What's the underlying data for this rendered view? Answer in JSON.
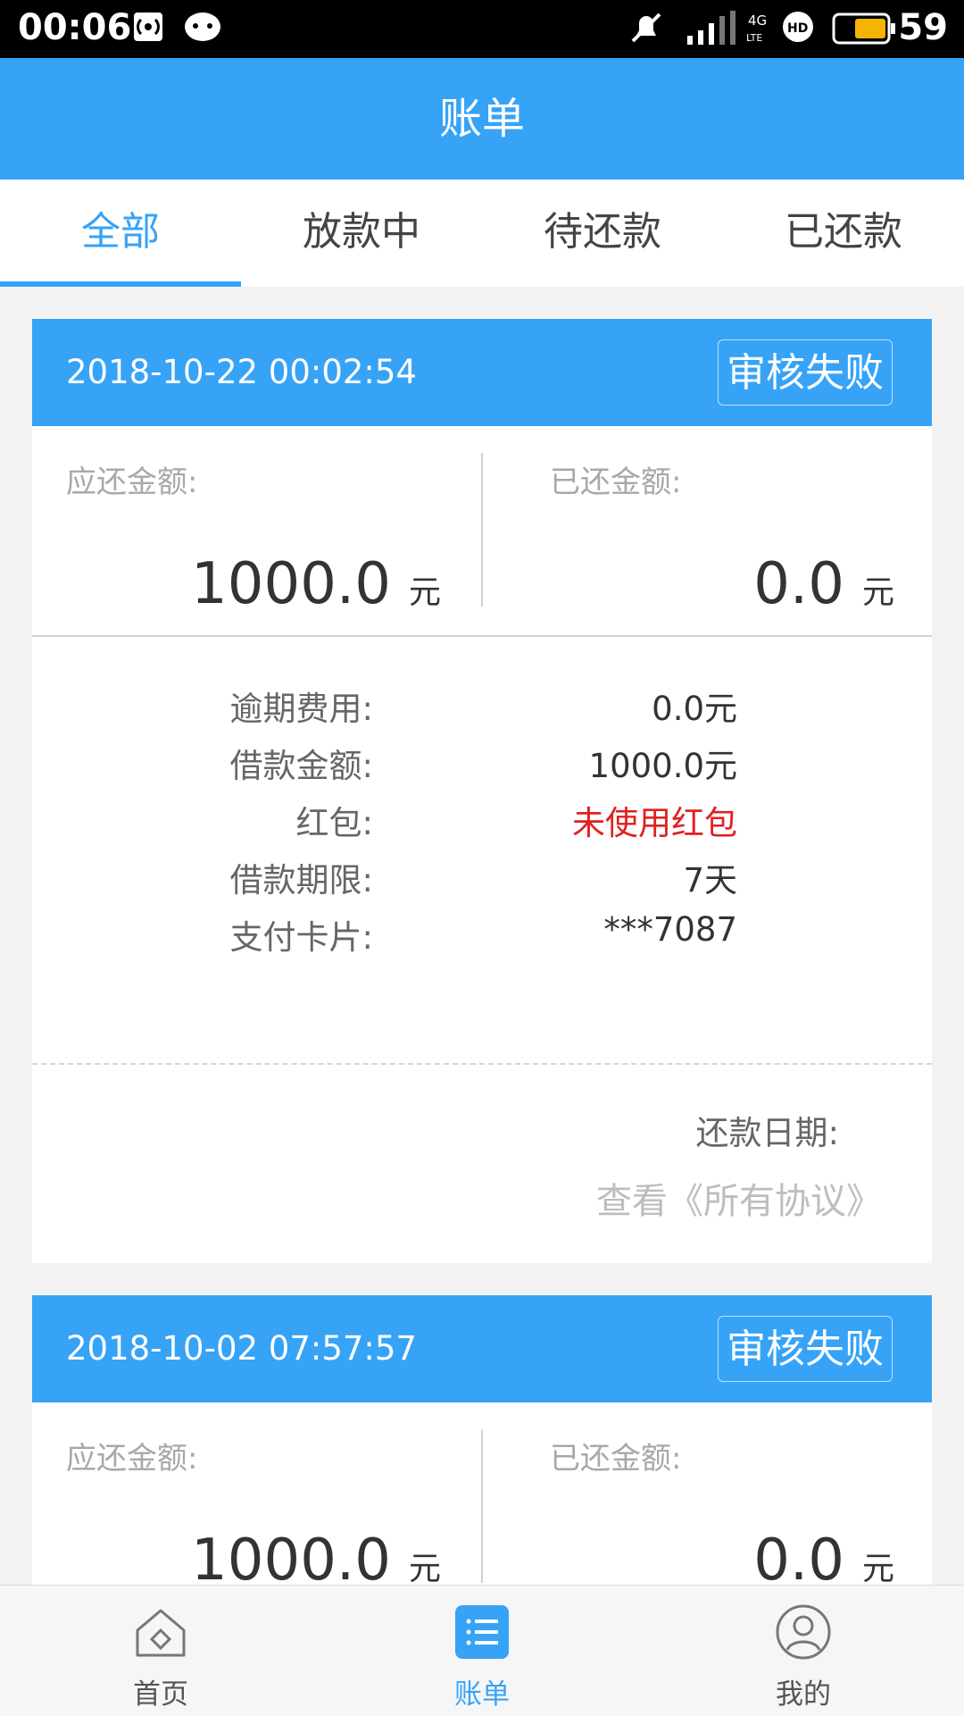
{
  "status_bar": {
    "time": "00:06",
    "battery": "59"
  },
  "header": {
    "title": "账单"
  },
  "tabs": [
    {
      "label": "全部"
    },
    {
      "label": "放款中"
    },
    {
      "label": "待还款"
    },
    {
      "label": "已还款"
    }
  ],
  "bills": [
    {
      "datetime": "2018-10-22 00:02:54",
      "status": "审核失败",
      "due_label": "应还金额:",
      "due_amount": "1000.0",
      "paid_label": "已还金额:",
      "paid_amount": "0.0",
      "unit": "元",
      "details": [
        {
          "label": "逾期费用:",
          "value": "0.0元"
        },
        {
          "label": "借款金额:",
          "value": "1000.0元"
        },
        {
          "label": "红包:",
          "value": "未使用红包"
        },
        {
          "label": "借款期限:",
          "value": "7天"
        },
        {
          "label": "支付卡片:",
          "value": "***7087"
        }
      ],
      "repay_date_label": "还款日期:",
      "agreement_link": "查看《所有协议》"
    },
    {
      "datetime": "2018-10-02 07:57:57",
      "status": "审核失败",
      "due_label": "应还金额:",
      "due_amount": "1000.0",
      "paid_label": "已还金额:",
      "paid_amount": "0.0",
      "unit": "元"
    }
  ],
  "bottom_nav": [
    {
      "label": "首页",
      "icon": "home-icon"
    },
    {
      "label": "账单",
      "icon": "bill-list-icon"
    },
    {
      "label": "我的",
      "icon": "profile-icon"
    }
  ],
  "colors": {
    "primary": "#36a3f7",
    "warning_red": "#e02020"
  }
}
